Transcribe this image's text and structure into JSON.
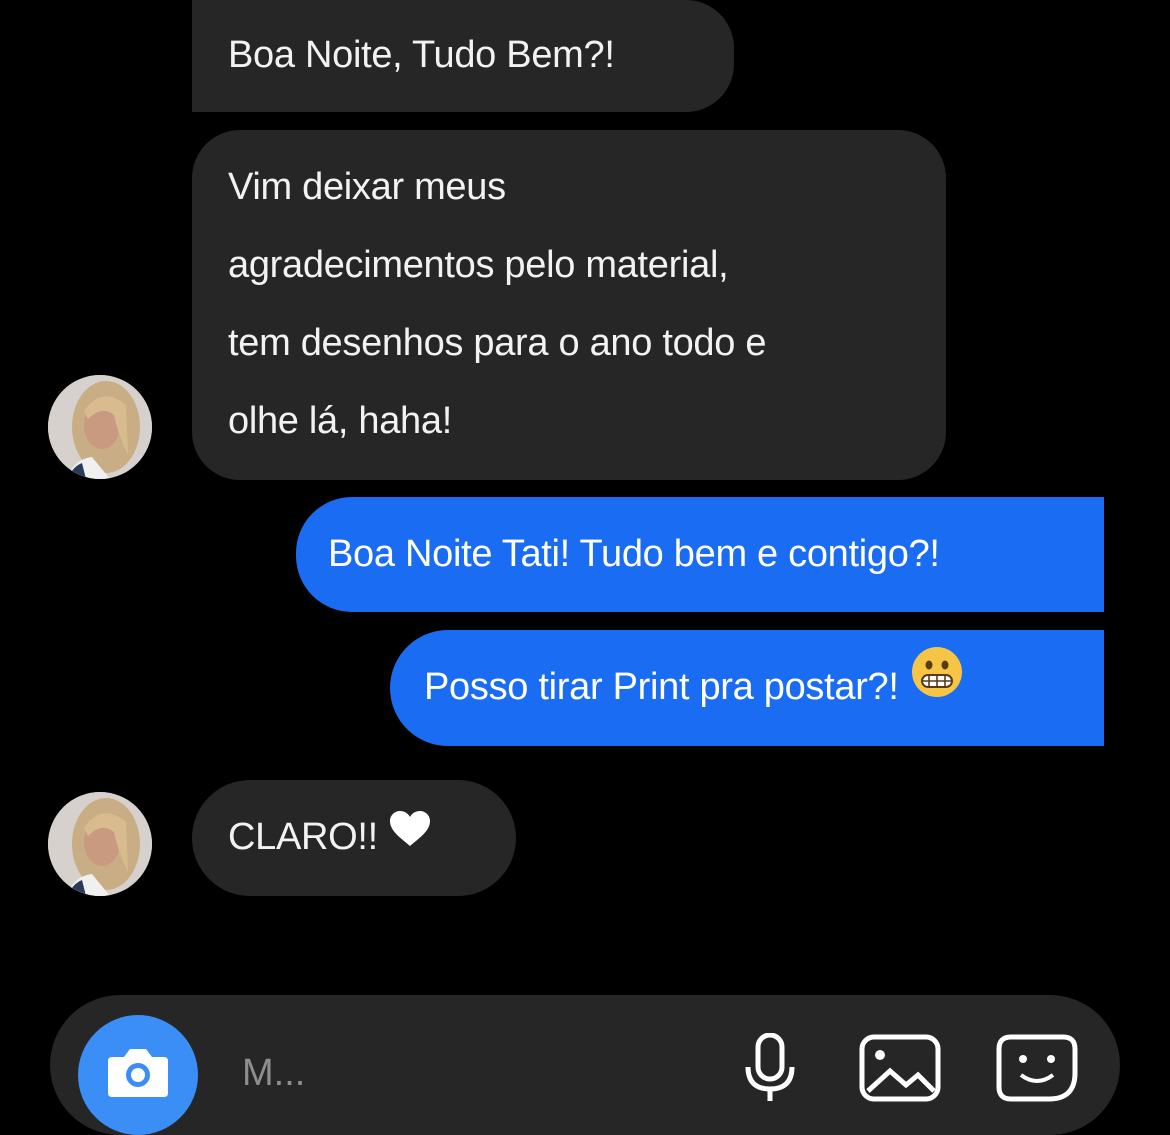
{
  "conversation": {
    "messages": [
      {
        "direction": "in",
        "lines": [
          "Boa Noite, Tudo Bem?!"
        ]
      },
      {
        "direction": "in",
        "lines": [
          "Vim deixar meus",
          "agradecimentos pelo material,",
          "tem desenhos para o ano todo e",
          "olhe lá, haha!"
        ]
      },
      {
        "direction": "out",
        "lines": [
          "Boa Noite Tati! Tudo bem e contigo?!"
        ]
      },
      {
        "direction": "out",
        "lines": [
          "Posso tirar Print pra postar?!"
        ],
        "emoji": "grimacing-face-icon"
      },
      {
        "direction": "in",
        "lines": [
          "CLARO!!"
        ],
        "emoji": "heart-icon"
      }
    ]
  },
  "composer": {
    "placeholder": "M..."
  },
  "colors": {
    "background": "#000000",
    "incoming_bubble": "#262626",
    "outgoing_bubble": "#1a6cf2",
    "camera_button": "#3a8ef6"
  }
}
